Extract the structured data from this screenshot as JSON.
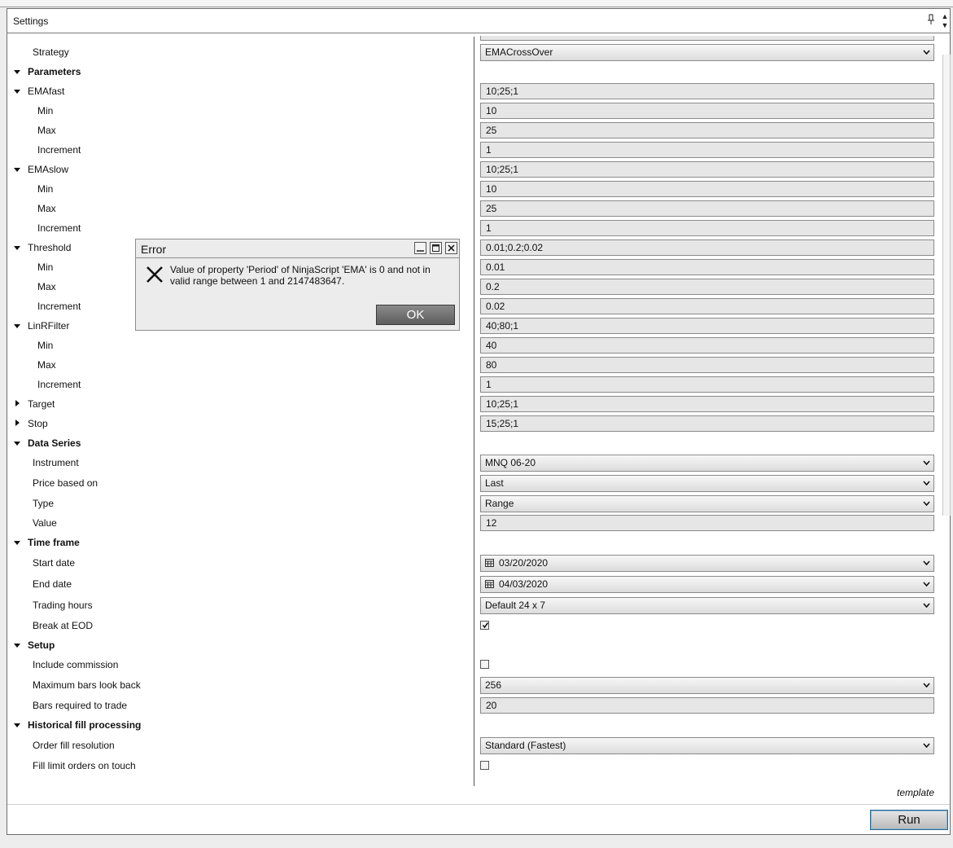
{
  "panel": {
    "title": "Settings"
  },
  "sections": {
    "strategy_label": "Strategy",
    "strategy_value": "EMACrossOver",
    "parameters": "Parameters",
    "emafast": {
      "label": "EMAfast",
      "value": "10;25;1",
      "min_label": "Min",
      "min": "10",
      "max_label": "Max",
      "max": "25",
      "inc_label": "Increment",
      "inc": "1"
    },
    "emaslow": {
      "label": "EMAslow",
      "value": "10;25;1",
      "min_label": "Min",
      "min": "10",
      "max_label": "Max",
      "max": "25",
      "inc_label": "Increment",
      "inc": "1"
    },
    "threshold": {
      "label": "Threshold",
      "value": "0.01;0.2;0.02",
      "min_label": "Min",
      "min": "0.01",
      "max_label": "Max",
      "max": "0.2",
      "inc_label": "Increment",
      "inc": "0.02"
    },
    "linrfilter": {
      "label": "LinRFilter",
      "value": "40;80;1",
      "min_label": "Min",
      "min": "40",
      "max_label": "Max",
      "max": "80",
      "inc_label": "Increment",
      "inc": "1"
    },
    "target": {
      "label": "Target",
      "value": "10;25;1"
    },
    "stop": {
      "label": "Stop",
      "value": "15;25;1"
    },
    "data_series": {
      "label": "Data Series",
      "instrument_label": "Instrument",
      "instrument": "MNQ 06-20",
      "price_label": "Price based on",
      "price": "Last",
      "type_label": "Type",
      "type": "Range",
      "value_label": "Value",
      "value": "12"
    },
    "time_frame": {
      "label": "Time frame",
      "start_label": "Start date",
      "start": "03/20/2020",
      "end_label": "End date",
      "end": "04/03/2020",
      "hours_label": "Trading hours",
      "hours": "Default 24 x 7",
      "eod_label": "Break at EOD",
      "eod_checked": true
    },
    "setup": {
      "label": "Setup",
      "commission_label": "Include commission",
      "commission_checked": false,
      "lookback_label": "Maximum bars look back",
      "lookback": "256",
      "bars_label": "Bars required to trade",
      "bars": "20"
    },
    "fill": {
      "label": "Historical fill processing",
      "resolution_label": "Order fill resolution",
      "resolution": "Standard (Fastest)",
      "touch_label": "Fill limit orders on touch",
      "touch_checked": false
    }
  },
  "footer": {
    "template": "template",
    "run": "Run"
  },
  "error_dialog": {
    "title": "Error",
    "message": "Value of property 'Period' of NinjaScript 'EMA' is 0 and not in valid range between 1 and 2147483647.",
    "ok": "OK"
  }
}
